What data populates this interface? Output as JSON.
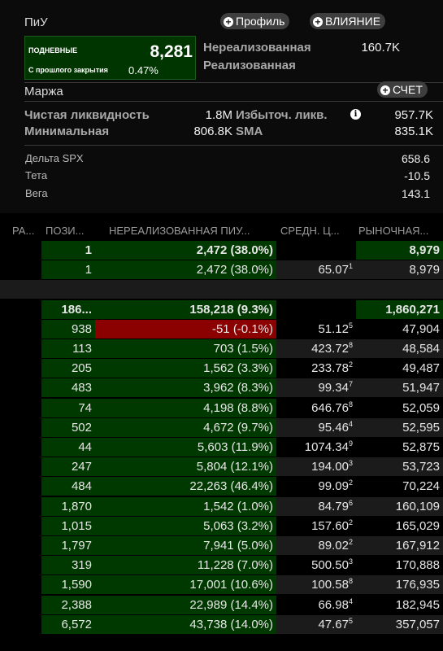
{
  "pnl": {
    "title": "ПиУ",
    "profile_button": "Профиль",
    "impact_button": "ВЛИЯНИЕ",
    "daily_label": "ПОДНЕВНЫЕ",
    "daily_value": "8,281",
    "since_close_label": "С прошлого закрытия",
    "since_close_pct": "0.47%",
    "unrealized_label": "Нереализованная",
    "unrealized_value": "160.7K",
    "realized_label": "Реализованная"
  },
  "margin": {
    "title": "Маржа",
    "account_button": "СЧЕТ",
    "net_liq_label": "Чистая ликвидность",
    "net_liq_value": "1.8M",
    "excess_liq_label": "Избыточ. ликв.",
    "excess_liq_value": "957.7K",
    "minimum_label": "Минимальная",
    "minimum_value": "806.8K",
    "sma_label": "SMA",
    "sma_value": "835.1K"
  },
  "greeks": [
    {
      "label": "Дельта SPX",
      "value": "658.6"
    },
    {
      "label": "Тета",
      "value": "-10.5"
    },
    {
      "label": "Вега",
      "value": "143.1"
    }
  ],
  "columns": [
    "РА...",
    "ПОЗИ...",
    "НЕРЕАЛИЗОВАННАЯ ПИУ...",
    "СРЕДН. Ц...",
    "РЫНОЧНАЯ..."
  ],
  "colors": {
    "green": "#003900",
    "red": "#8b0000",
    "row_dark": "#000000",
    "row_light": "#1b1b1b"
  },
  "rows": [
    {
      "kind": "group",
      "position": "1",
      "pnl": "2,472 (38.0%)",
      "avg": "",
      "avg_sup": "",
      "market": "8,979",
      "pnl_color": "green"
    },
    {
      "kind": "item",
      "position": "1",
      "pnl": "2,472 (38.0%)",
      "avg": "65.07",
      "avg_sup": "1",
      "market": "8,979",
      "pnl_color": "green"
    },
    {
      "kind": "spacer"
    },
    {
      "kind": "group",
      "position": "186...",
      "pnl": "158,218 (9.3%)",
      "avg": "",
      "avg_sup": "",
      "market": "1,860,271",
      "pnl_color": "green"
    },
    {
      "kind": "item",
      "position": "938",
      "pnl": "-51 (-0.1%)",
      "avg": "51.12",
      "avg_sup": "5",
      "market": "47,904",
      "pnl_color": "red"
    },
    {
      "kind": "item",
      "position": "113",
      "pnl": "703 (1.5%)",
      "avg": "423.72",
      "avg_sup": "8",
      "market": "48,584",
      "pnl_color": "green"
    },
    {
      "kind": "item",
      "position": "205",
      "pnl": "1,562 (3.3%)",
      "avg": "233.78",
      "avg_sup": "2",
      "market": "49,487",
      "pnl_color": "green"
    },
    {
      "kind": "item",
      "position": "483",
      "pnl": "3,962 (8.3%)",
      "avg": "99.34",
      "avg_sup": "7",
      "market": "51,947",
      "pnl_color": "green"
    },
    {
      "kind": "item",
      "position": "74",
      "pnl": "4,198 (8.8%)",
      "avg": "646.76",
      "avg_sup": "8",
      "market": "52,059",
      "pnl_color": "green"
    },
    {
      "kind": "item",
      "position": "502",
      "pnl": "4,672 (9.7%)",
      "avg": "95.46",
      "avg_sup": "4",
      "market": "52,595",
      "pnl_color": "green"
    },
    {
      "kind": "item",
      "position": "44",
      "pnl": "5,603 (11.9%)",
      "avg": "1074.34",
      "avg_sup": "9",
      "market": "52,875",
      "pnl_color": "green"
    },
    {
      "kind": "item",
      "position": "247",
      "pnl": "5,804 (12.1%)",
      "avg": "194.00",
      "avg_sup": "3",
      "market": "53,723",
      "pnl_color": "green"
    },
    {
      "kind": "item",
      "position": "484",
      "pnl": "22,263 (46.4%)",
      "avg": "99.09",
      "avg_sup": "2",
      "market": "70,224",
      "pnl_color": "green"
    },
    {
      "kind": "item",
      "position": "1,870",
      "pnl": "1,542 (1.0%)",
      "avg": "84.79",
      "avg_sup": "6",
      "market": "160,109",
      "pnl_color": "green"
    },
    {
      "kind": "item",
      "position": "1,015",
      "pnl": "5,063 (3.2%)",
      "avg": "157.60",
      "avg_sup": "2",
      "market": "165,029",
      "pnl_color": "green"
    },
    {
      "kind": "item",
      "position": "1,797",
      "pnl": "7,941 (5.0%)",
      "avg": "89.02",
      "avg_sup": "2",
      "market": "167,912",
      "pnl_color": "green"
    },
    {
      "kind": "item",
      "position": "319",
      "pnl": "11,228 (7.0%)",
      "avg": "500.50",
      "avg_sup": "3",
      "market": "170,888",
      "pnl_color": "green"
    },
    {
      "kind": "item",
      "position": "1,590",
      "pnl": "17,001 (10.6%)",
      "avg": "100.58",
      "avg_sup": "8",
      "market": "176,935",
      "pnl_color": "green"
    },
    {
      "kind": "item",
      "position": "2,388",
      "pnl": "22,989 (14.4%)",
      "avg": "66.98",
      "avg_sup": "4",
      "market": "182,945",
      "pnl_color": "green"
    },
    {
      "kind": "item",
      "position": "6,572",
      "pnl": "43,738 (14.0%)",
      "avg": "47.67",
      "avg_sup": "5",
      "market": "357,057",
      "pnl_color": "green"
    }
  ]
}
